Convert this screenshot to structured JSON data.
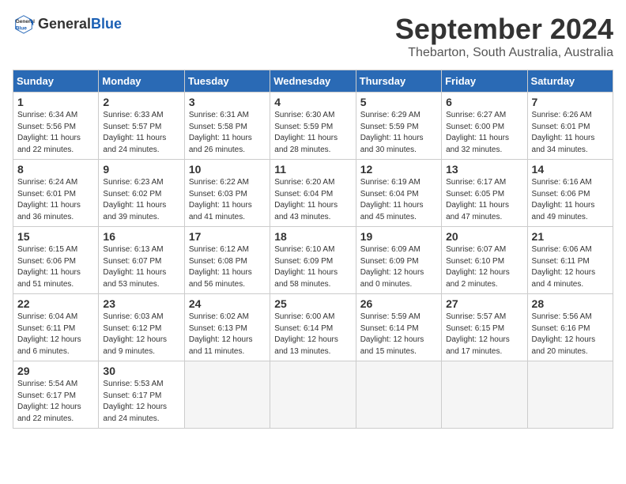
{
  "logo": {
    "general": "General",
    "blue": "Blue"
  },
  "title": "September 2024",
  "location": "Thebarton, South Australia, Australia",
  "days_of_week": [
    "Sunday",
    "Monday",
    "Tuesday",
    "Wednesday",
    "Thursday",
    "Friday",
    "Saturday"
  ],
  "weeks": [
    [
      {
        "day": "1",
        "sunrise": "6:34 AM",
        "sunset": "5:56 PM",
        "daylight": "11 hours and 22 minutes."
      },
      {
        "day": "2",
        "sunrise": "6:33 AM",
        "sunset": "5:57 PM",
        "daylight": "11 hours and 24 minutes."
      },
      {
        "day": "3",
        "sunrise": "6:31 AM",
        "sunset": "5:58 PM",
        "daylight": "11 hours and 26 minutes."
      },
      {
        "day": "4",
        "sunrise": "6:30 AM",
        "sunset": "5:59 PM",
        "daylight": "11 hours and 28 minutes."
      },
      {
        "day": "5",
        "sunrise": "6:29 AM",
        "sunset": "5:59 PM",
        "daylight": "11 hours and 30 minutes."
      },
      {
        "day": "6",
        "sunrise": "6:27 AM",
        "sunset": "6:00 PM",
        "daylight": "11 hours and 32 minutes."
      },
      {
        "day": "7",
        "sunrise": "6:26 AM",
        "sunset": "6:01 PM",
        "daylight": "11 hours and 34 minutes."
      }
    ],
    [
      {
        "day": "8",
        "sunrise": "6:24 AM",
        "sunset": "6:01 PM",
        "daylight": "11 hours and 36 minutes."
      },
      {
        "day": "9",
        "sunrise": "6:23 AM",
        "sunset": "6:02 PM",
        "daylight": "11 hours and 39 minutes."
      },
      {
        "day": "10",
        "sunrise": "6:22 AM",
        "sunset": "6:03 PM",
        "daylight": "11 hours and 41 minutes."
      },
      {
        "day": "11",
        "sunrise": "6:20 AM",
        "sunset": "6:04 PM",
        "daylight": "11 hours and 43 minutes."
      },
      {
        "day": "12",
        "sunrise": "6:19 AM",
        "sunset": "6:04 PM",
        "daylight": "11 hours and 45 minutes."
      },
      {
        "day": "13",
        "sunrise": "6:17 AM",
        "sunset": "6:05 PM",
        "daylight": "11 hours and 47 minutes."
      },
      {
        "day": "14",
        "sunrise": "6:16 AM",
        "sunset": "6:06 PM",
        "daylight": "11 hours and 49 minutes."
      }
    ],
    [
      {
        "day": "15",
        "sunrise": "6:15 AM",
        "sunset": "6:06 PM",
        "daylight": "11 hours and 51 minutes."
      },
      {
        "day": "16",
        "sunrise": "6:13 AM",
        "sunset": "6:07 PM",
        "daylight": "11 hours and 53 minutes."
      },
      {
        "day": "17",
        "sunrise": "6:12 AM",
        "sunset": "6:08 PM",
        "daylight": "11 hours and 56 minutes."
      },
      {
        "day": "18",
        "sunrise": "6:10 AM",
        "sunset": "6:09 PM",
        "daylight": "11 hours and 58 minutes."
      },
      {
        "day": "19",
        "sunrise": "6:09 AM",
        "sunset": "6:09 PM",
        "daylight": "12 hours and 0 minutes."
      },
      {
        "day": "20",
        "sunrise": "6:07 AM",
        "sunset": "6:10 PM",
        "daylight": "12 hours and 2 minutes."
      },
      {
        "day": "21",
        "sunrise": "6:06 AM",
        "sunset": "6:11 PM",
        "daylight": "12 hours and 4 minutes."
      }
    ],
    [
      {
        "day": "22",
        "sunrise": "6:04 AM",
        "sunset": "6:11 PM",
        "daylight": "12 hours and 6 minutes."
      },
      {
        "day": "23",
        "sunrise": "6:03 AM",
        "sunset": "6:12 PM",
        "daylight": "12 hours and 9 minutes."
      },
      {
        "day": "24",
        "sunrise": "6:02 AM",
        "sunset": "6:13 PM",
        "daylight": "12 hours and 11 minutes."
      },
      {
        "day": "25",
        "sunrise": "6:00 AM",
        "sunset": "6:14 PM",
        "daylight": "12 hours and 13 minutes."
      },
      {
        "day": "26",
        "sunrise": "5:59 AM",
        "sunset": "6:14 PM",
        "daylight": "12 hours and 15 minutes."
      },
      {
        "day": "27",
        "sunrise": "5:57 AM",
        "sunset": "6:15 PM",
        "daylight": "12 hours and 17 minutes."
      },
      {
        "day": "28",
        "sunrise": "5:56 AM",
        "sunset": "6:16 PM",
        "daylight": "12 hours and 20 minutes."
      }
    ],
    [
      {
        "day": "29",
        "sunrise": "5:54 AM",
        "sunset": "6:17 PM",
        "daylight": "12 hours and 22 minutes."
      },
      {
        "day": "30",
        "sunrise": "5:53 AM",
        "sunset": "6:17 PM",
        "daylight": "12 hours and 24 minutes."
      },
      null,
      null,
      null,
      null,
      null
    ]
  ]
}
